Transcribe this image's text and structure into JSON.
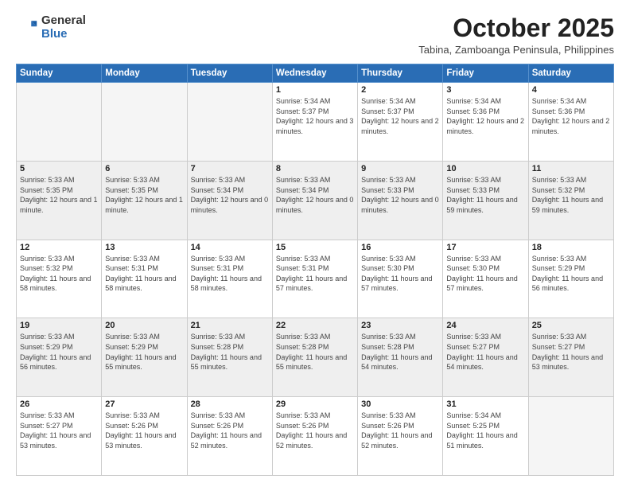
{
  "logo": {
    "general": "General",
    "blue": "Blue"
  },
  "title": "October 2025",
  "subtitle": "Tabina, Zamboanga Peninsula, Philippines",
  "days_of_week": [
    "Sunday",
    "Monday",
    "Tuesday",
    "Wednesday",
    "Thursday",
    "Friday",
    "Saturday"
  ],
  "weeks": [
    [
      {
        "day": "",
        "info": ""
      },
      {
        "day": "",
        "info": ""
      },
      {
        "day": "",
        "info": ""
      },
      {
        "day": "1",
        "info": "Sunrise: 5:34 AM\nSunset: 5:37 PM\nDaylight: 12 hours and 3 minutes."
      },
      {
        "day": "2",
        "info": "Sunrise: 5:34 AM\nSunset: 5:37 PM\nDaylight: 12 hours and 2 minutes."
      },
      {
        "day": "3",
        "info": "Sunrise: 5:34 AM\nSunset: 5:36 PM\nDaylight: 12 hours and 2 minutes."
      },
      {
        "day": "4",
        "info": "Sunrise: 5:34 AM\nSunset: 5:36 PM\nDaylight: 12 hours and 2 minutes."
      }
    ],
    [
      {
        "day": "5",
        "info": "Sunrise: 5:33 AM\nSunset: 5:35 PM\nDaylight: 12 hours and 1 minute."
      },
      {
        "day": "6",
        "info": "Sunrise: 5:33 AM\nSunset: 5:35 PM\nDaylight: 12 hours and 1 minute."
      },
      {
        "day": "7",
        "info": "Sunrise: 5:33 AM\nSunset: 5:34 PM\nDaylight: 12 hours and 0 minutes."
      },
      {
        "day": "8",
        "info": "Sunrise: 5:33 AM\nSunset: 5:34 PM\nDaylight: 12 hours and 0 minutes."
      },
      {
        "day": "9",
        "info": "Sunrise: 5:33 AM\nSunset: 5:33 PM\nDaylight: 12 hours and 0 minutes."
      },
      {
        "day": "10",
        "info": "Sunrise: 5:33 AM\nSunset: 5:33 PM\nDaylight: 11 hours and 59 minutes."
      },
      {
        "day": "11",
        "info": "Sunrise: 5:33 AM\nSunset: 5:32 PM\nDaylight: 11 hours and 59 minutes."
      }
    ],
    [
      {
        "day": "12",
        "info": "Sunrise: 5:33 AM\nSunset: 5:32 PM\nDaylight: 11 hours and 58 minutes."
      },
      {
        "day": "13",
        "info": "Sunrise: 5:33 AM\nSunset: 5:31 PM\nDaylight: 11 hours and 58 minutes."
      },
      {
        "day": "14",
        "info": "Sunrise: 5:33 AM\nSunset: 5:31 PM\nDaylight: 11 hours and 58 minutes."
      },
      {
        "day": "15",
        "info": "Sunrise: 5:33 AM\nSunset: 5:31 PM\nDaylight: 11 hours and 57 minutes."
      },
      {
        "day": "16",
        "info": "Sunrise: 5:33 AM\nSunset: 5:30 PM\nDaylight: 11 hours and 57 minutes."
      },
      {
        "day": "17",
        "info": "Sunrise: 5:33 AM\nSunset: 5:30 PM\nDaylight: 11 hours and 57 minutes."
      },
      {
        "day": "18",
        "info": "Sunrise: 5:33 AM\nSunset: 5:29 PM\nDaylight: 11 hours and 56 minutes."
      }
    ],
    [
      {
        "day": "19",
        "info": "Sunrise: 5:33 AM\nSunset: 5:29 PM\nDaylight: 11 hours and 56 minutes."
      },
      {
        "day": "20",
        "info": "Sunrise: 5:33 AM\nSunset: 5:29 PM\nDaylight: 11 hours and 55 minutes."
      },
      {
        "day": "21",
        "info": "Sunrise: 5:33 AM\nSunset: 5:28 PM\nDaylight: 11 hours and 55 minutes."
      },
      {
        "day": "22",
        "info": "Sunrise: 5:33 AM\nSunset: 5:28 PM\nDaylight: 11 hours and 55 minutes."
      },
      {
        "day": "23",
        "info": "Sunrise: 5:33 AM\nSunset: 5:28 PM\nDaylight: 11 hours and 54 minutes."
      },
      {
        "day": "24",
        "info": "Sunrise: 5:33 AM\nSunset: 5:27 PM\nDaylight: 11 hours and 54 minutes."
      },
      {
        "day": "25",
        "info": "Sunrise: 5:33 AM\nSunset: 5:27 PM\nDaylight: 11 hours and 53 minutes."
      }
    ],
    [
      {
        "day": "26",
        "info": "Sunrise: 5:33 AM\nSunset: 5:27 PM\nDaylight: 11 hours and 53 minutes."
      },
      {
        "day": "27",
        "info": "Sunrise: 5:33 AM\nSunset: 5:26 PM\nDaylight: 11 hours and 53 minutes."
      },
      {
        "day": "28",
        "info": "Sunrise: 5:33 AM\nSunset: 5:26 PM\nDaylight: 11 hours and 52 minutes."
      },
      {
        "day": "29",
        "info": "Sunrise: 5:33 AM\nSunset: 5:26 PM\nDaylight: 11 hours and 52 minutes."
      },
      {
        "day": "30",
        "info": "Sunrise: 5:33 AM\nSunset: 5:26 PM\nDaylight: 11 hours and 52 minutes."
      },
      {
        "day": "31",
        "info": "Sunrise: 5:34 AM\nSunset: 5:25 PM\nDaylight: 11 hours and 51 minutes."
      },
      {
        "day": "",
        "info": ""
      }
    ]
  ],
  "colors": {
    "header_bg": "#2a6db5",
    "alt_row_bg": "#efefef",
    "normal_row_bg": "#ffffff",
    "empty_bg": "#f5f5f5"
  }
}
